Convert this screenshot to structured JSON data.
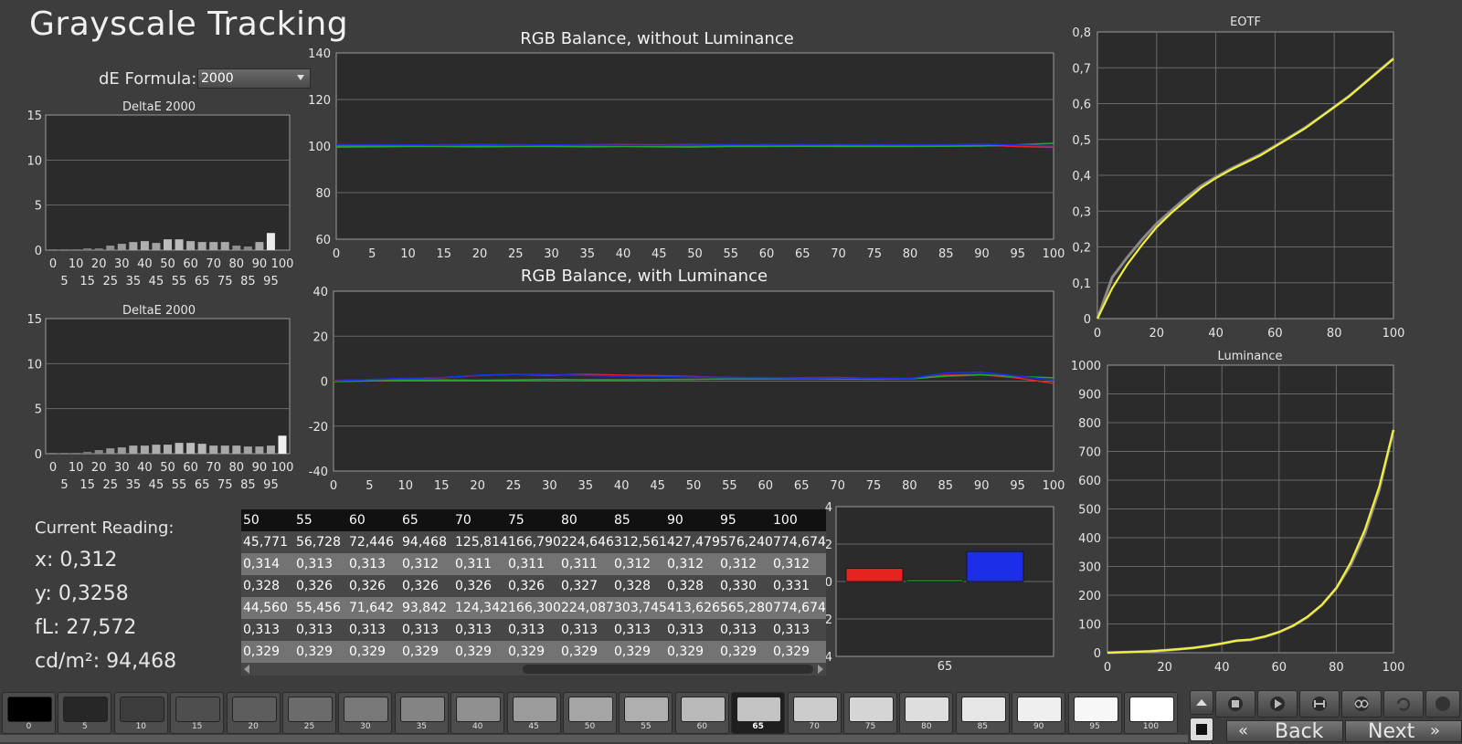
{
  "title": "Grayscale Tracking",
  "de_formula": {
    "label": "dE Formula:",
    "value": "2000"
  },
  "colors": {
    "red": "#e8231f",
    "green": "#1fa82a",
    "blue": "#1d2ee8",
    "purple": "#a23cc4",
    "yellow": "#f2f03a",
    "bg": "#3d3d3d",
    "plot_bg": "#2b2b2b"
  },
  "chart_data": [
    {
      "type": "bar",
      "title": "DeltaE 2000",
      "categories": [
        "0",
        "5",
        "10",
        "15",
        "20",
        "25",
        "30",
        "35",
        "40",
        "45",
        "50",
        "55",
        "60",
        "65",
        "70",
        "75",
        "80",
        "85",
        "90",
        "95",
        "100"
      ],
      "values": [
        0.1,
        0.1,
        0.1,
        0.2,
        0.2,
        0.5,
        0.7,
        0.9,
        1.0,
        0.8,
        1.2,
        1.2,
        1.0,
        0.9,
        0.9,
        0.9,
        0.5,
        0.4,
        0.9,
        1.9,
        0
      ],
      "ylim": [
        0,
        15
      ],
      "yticks": [
        "0",
        "5",
        "10",
        "15"
      ],
      "xticks_top": [
        "0",
        "10",
        "20",
        "30",
        "40",
        "50",
        "60",
        "70",
        "80",
        "90",
        "100"
      ],
      "xticks_bottom": [
        "5",
        "15",
        "25",
        "35",
        "45",
        "55",
        "65",
        "75",
        "85",
        "95"
      ]
    },
    {
      "type": "bar",
      "title": "DeltaE 2000",
      "categories": [
        "0",
        "5",
        "10",
        "15",
        "20",
        "25",
        "30",
        "35",
        "40",
        "45",
        "50",
        "55",
        "60",
        "65",
        "70",
        "75",
        "80",
        "85",
        "90",
        "95",
        "100"
      ],
      "values": [
        0.1,
        0.1,
        0.1,
        0.2,
        0.4,
        0.6,
        0.7,
        0.9,
        0.9,
        1.0,
        1.0,
        1.2,
        1.2,
        1.1,
        0.9,
        0.9,
        0.9,
        0.8,
        0.8,
        0.9,
        2.0
      ],
      "ylim": [
        0,
        15
      ],
      "yticks": [
        "0",
        "5",
        "10",
        "15"
      ],
      "xticks_top": [
        "0",
        "10",
        "20",
        "30",
        "40",
        "50",
        "60",
        "70",
        "80",
        "90",
        "100"
      ],
      "xticks_bottom": [
        "5",
        "15",
        "25",
        "35",
        "45",
        "55",
        "65",
        "75",
        "85",
        "95"
      ]
    },
    {
      "type": "line",
      "title": "RGB Balance, without Luminance",
      "x": [
        0,
        5,
        10,
        15,
        20,
        25,
        30,
        35,
        40,
        45,
        50,
        55,
        60,
        65,
        70,
        75,
        80,
        85,
        90,
        95,
        100
      ],
      "xticks": [
        "0",
        "5",
        "10",
        "15",
        "20",
        "25",
        "30",
        "35",
        "40",
        "45",
        "50",
        "55",
        "60",
        "65",
        "70",
        "75",
        "80",
        "85",
        "90",
        "95",
        "100"
      ],
      "yticks": [
        "60",
        "80",
        "100",
        "120",
        "140"
      ],
      "ylim": [
        60,
        140
      ],
      "series": [
        {
          "color_key": "red",
          "values": [
            100.3,
            100.4,
            100.4,
            100.5,
            100.6,
            100.5,
            100.4,
            100.5,
            100.6,
            100.5,
            100.6,
            100.5,
            100.6,
            100.5,
            100.4,
            100.5,
            100.5,
            100.4,
            100.4,
            99.8,
            99.5
          ]
        },
        {
          "color_key": "green",
          "values": [
            99.6,
            99.7,
            99.8,
            99.8,
            99.7,
            99.8,
            99.8,
            99.7,
            99.8,
            99.7,
            99.6,
            99.8,
            99.8,
            99.9,
            99.8,
            99.8,
            99.8,
            99.9,
            100.0,
            100.5,
            101.2
          ]
        },
        {
          "color_key": "blue",
          "values": [
            100.7,
            100.6,
            100.5,
            100.4,
            100.5,
            100.4,
            100.5,
            100.4,
            100.3,
            100.3,
            100.4,
            100.6,
            100.7,
            100.6,
            100.7,
            100.6,
            100.5,
            100.6,
            100.8,
            100.4,
            100.1
          ]
        }
      ]
    },
    {
      "type": "line",
      "title": "RGB Balance, with Luminance",
      "x": [
        0,
        5,
        10,
        15,
        20,
        25,
        30,
        35,
        40,
        45,
        50,
        55,
        60,
        65,
        70,
        75,
        80,
        85,
        90,
        95,
        100
      ],
      "xticks": [
        "0",
        "5",
        "10",
        "15",
        "20",
        "25",
        "30",
        "35",
        "40",
        "45",
        "50",
        "55",
        "60",
        "65",
        "70",
        "75",
        "80",
        "85",
        "90",
        "95",
        "100"
      ],
      "yticks": [
        "-40",
        "-20",
        "0",
        "20",
        "40"
      ],
      "ylim": [
        -40,
        40
      ],
      "series": [
        {
          "color_key": "red",
          "values": [
            0.3,
            0.5,
            1.0,
            1.5,
            2.5,
            3.0,
            2.6,
            3.0,
            2.6,
            2.4,
            2.0,
            1.6,
            1.4,
            1.5,
            1.6,
            1.2,
            1.2,
            2.6,
            2.9,
            1.4,
            -1.0
          ]
        },
        {
          "color_key": "green",
          "values": [
            -0.2,
            0.1,
            0.3,
            0.5,
            0.4,
            0.5,
            0.7,
            0.6,
            0.6,
            0.7,
            0.8,
            1.0,
            1.0,
            1.1,
            1.0,
            0.9,
            1.0,
            2.2,
            2.8,
            2.0,
            1.5
          ]
        },
        {
          "color_key": "blue",
          "values": [
            0.1,
            0.7,
            1.2,
            1.6,
            2.6,
            3.0,
            2.9,
            2.5,
            2.2,
            2.0,
            1.8,
            1.6,
            1.5,
            1.4,
            1.4,
            1.2,
            1.1,
            3.6,
            4.0,
            2.2,
            0.5
          ]
        }
      ]
    },
    {
      "type": "line",
      "title": "EOTF",
      "xticks": [
        "0",
        "20",
        "40",
        "60",
        "80",
        "100"
      ],
      "xlim": [
        0,
        100
      ],
      "yticks": [
        "0",
        "0,1",
        "0,2",
        "0,3",
        "0,4",
        "0,5",
        "0,6",
        "0,7",
        "0,8"
      ],
      "ylim": [
        0,
        0.8
      ],
      "series": [
        {
          "color_key": "yellow",
          "x": [
            0,
            5,
            10,
            15,
            20,
            25,
            30,
            35,
            40,
            45,
            50,
            55,
            60,
            65,
            70,
            75,
            80,
            85,
            90,
            95,
            100
          ],
          "values": [
            0.0,
            0.085,
            0.15,
            0.205,
            0.255,
            0.295,
            0.33,
            0.365,
            0.392,
            0.415,
            0.435,
            0.455,
            0.48,
            0.505,
            0.53,
            0.56,
            0.59,
            0.62,
            0.655,
            0.69,
            0.725
          ]
        },
        {
          "color": "#8a8a8a",
          "x": [
            0,
            5,
            10,
            15,
            20,
            25,
            30,
            35,
            40,
            45,
            50,
            55,
            60,
            65,
            70,
            75,
            80,
            85,
            90,
            95,
            100
          ],
          "values": [
            0.0,
            0.115,
            0.17,
            0.22,
            0.265,
            0.302,
            0.338,
            0.37,
            0.395,
            0.418,
            0.438,
            0.458,
            0.482,
            0.507,
            0.532,
            0.561,
            0.591,
            0.621,
            0.656,
            0.691,
            0.726
          ]
        }
      ]
    },
    {
      "type": "line",
      "title": "Luminance",
      "xticks": [
        "0",
        "20",
        "40",
        "60",
        "80",
        "100"
      ],
      "xlim": [
        0,
        100
      ],
      "yticks": [
        "0",
        "100",
        "200",
        "300",
        "400",
        "500",
        "600",
        "700",
        "800",
        "900",
        "1000"
      ],
      "ylim": [
        0,
        1000
      ],
      "series": [
        {
          "color_key": "yellow",
          "x": [
            0,
            5,
            10,
            15,
            20,
            25,
            30,
            35,
            40,
            45,
            50,
            55,
            60,
            65,
            70,
            75,
            80,
            85,
            90,
            95,
            100
          ],
          "values": [
            0,
            1.5,
            3,
            5,
            8.6,
            12.4,
            16.8,
            23.6,
            31.9,
            41.7,
            45.8,
            56.7,
            72.4,
            94.5,
            125.8,
            166.8,
            224.6,
            312.6,
            427.5,
            576.2,
            774.7
          ]
        },
        {
          "color": "#8a8a8a",
          "x": [
            0,
            5,
            10,
            15,
            20,
            25,
            30,
            35,
            40,
            45,
            50,
            55,
            60,
            65,
            70,
            75,
            80,
            85,
            90,
            95,
            100
          ],
          "values": [
            0,
            1.5,
            3,
            5,
            8.5,
            12.3,
            16.7,
            23.5,
            31.8,
            41.5,
            44.6,
            55.5,
            71.6,
            93.8,
            124.3,
            166.3,
            224.1,
            303.7,
            413.6,
            565.3,
            774.7
          ]
        }
      ]
    },
    {
      "type": "bar",
      "category": "65",
      "xlabel": "65",
      "yticks": [
        "-4",
        "-2",
        "0",
        "2",
        "4"
      ],
      "ylim": [
        -4,
        4
      ],
      "series": [
        {
          "color_key": "red",
          "value": 0.7
        },
        {
          "color_key": "green",
          "value": 0.1
        },
        {
          "color_key": "blue",
          "value": 1.6
        }
      ]
    }
  ],
  "current_reading": {
    "header": "Current Reading:",
    "x": "x: 0,312",
    "y": "y: 0,3258",
    "fl": "fL: 27,572",
    "cdm2": "cd/m²: 94,468"
  },
  "table": {
    "header": [
      "50",
      "55",
      "60",
      "65",
      "70",
      "75",
      "80",
      "85",
      "90",
      "95",
      "100"
    ],
    "rows": [
      [
        "45,771",
        "56,728",
        "72,446",
        "94,468",
        "125,814",
        "166,790",
        "224,646",
        "312,561",
        "427,479",
        "576,240",
        "774,674"
      ],
      [
        "0,314",
        "0,313",
        "0,313",
        "0,312",
        "0,311",
        "0,311",
        "0,311",
        "0,312",
        "0,312",
        "0,312",
        "0,312"
      ],
      [
        "0,328",
        "0,326",
        "0,326",
        "0,326",
        "0,326",
        "0,326",
        "0,327",
        "0,328",
        "0,328",
        "0,330",
        "0,331"
      ],
      [
        "44,560",
        "55,456",
        "71,642",
        "93,842",
        "124,342",
        "166,300",
        "224,087",
        "303,745",
        "413,626",
        "565,280",
        "774,674"
      ],
      [
        "0,313",
        "0,313",
        "0,313",
        "0,313",
        "0,313",
        "0,313",
        "0,313",
        "0,313",
        "0,313",
        "0,313",
        "0,313"
      ],
      [
        "0,329",
        "0,329",
        "0,329",
        "0,329",
        "0,329",
        "0,329",
        "0,329",
        "0,329",
        "0,329",
        "0,329",
        "0,329"
      ]
    ]
  },
  "patches": {
    "labels": [
      "0",
      "5",
      "10",
      "15",
      "20",
      "25",
      "30",
      "35",
      "40",
      "45",
      "50",
      "55",
      "60",
      "65",
      "70",
      "75",
      "80",
      "85",
      "90",
      "95",
      "100"
    ],
    "selected": "65"
  },
  "nav": {
    "back": "Back",
    "next": "Next"
  },
  "icons": [
    "stop-icon",
    "play-icon",
    "loop-range-icon",
    "infinite-icon",
    "refresh-icon",
    "record-icon"
  ]
}
